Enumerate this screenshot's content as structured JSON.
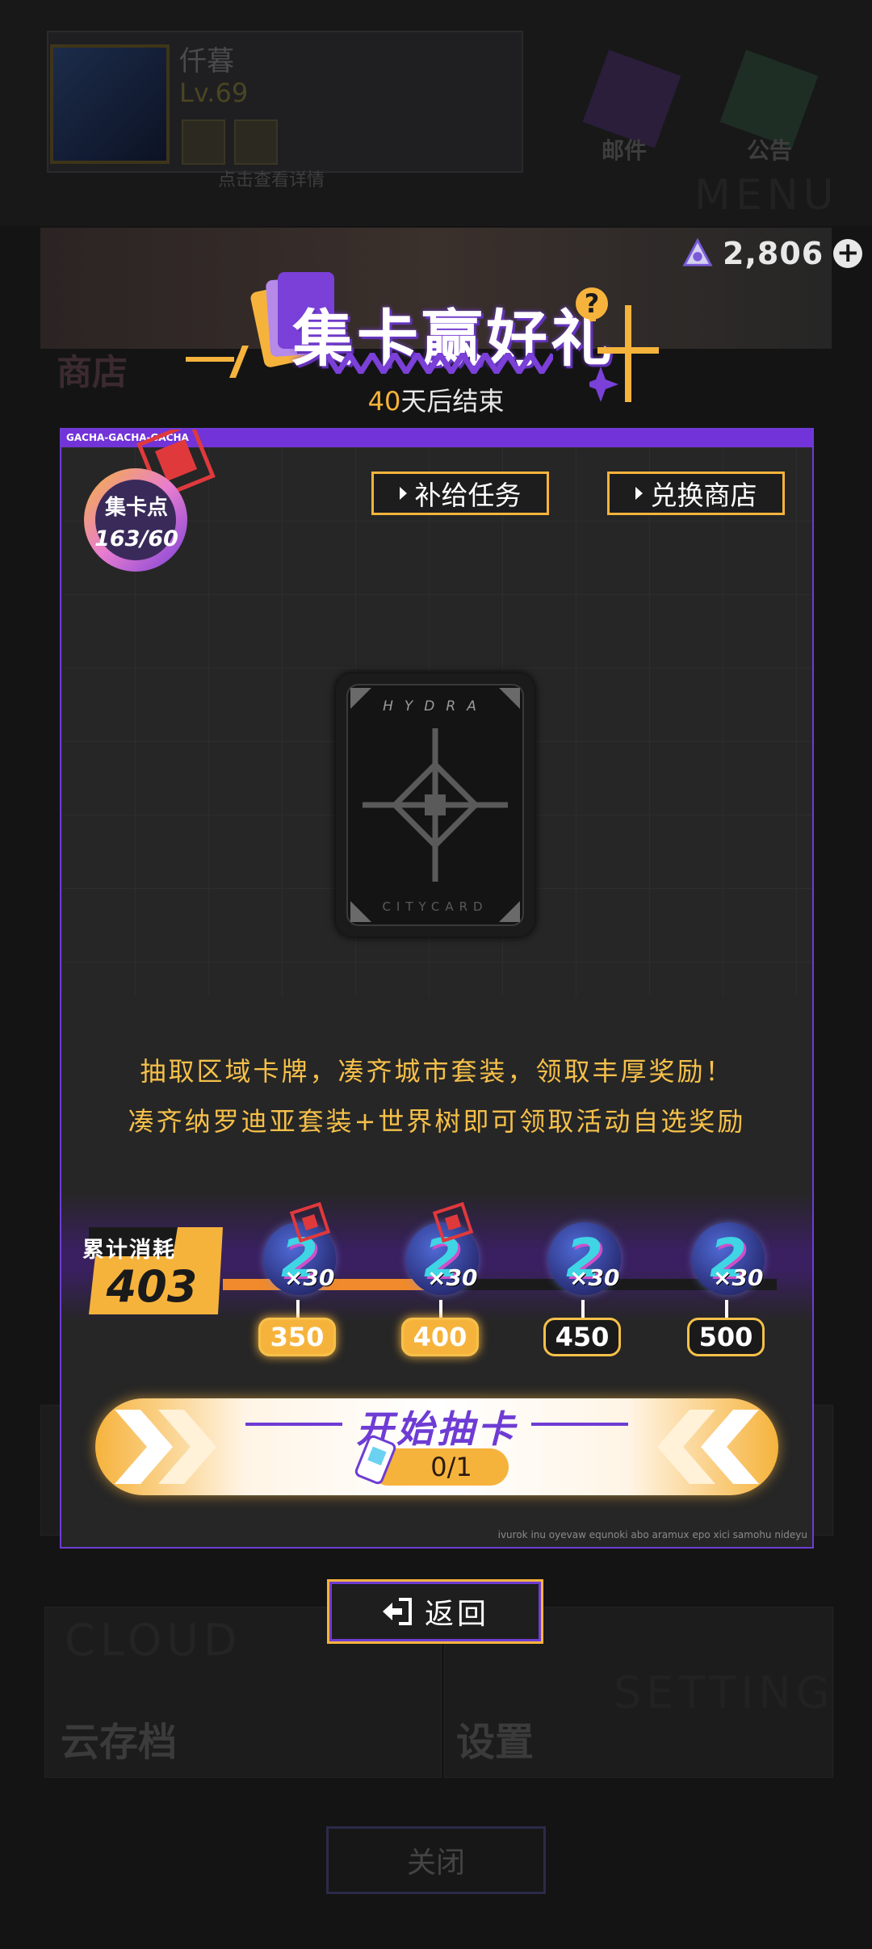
{
  "background": {
    "profile": {
      "name": "仟暮",
      "level": "Lv.69",
      "hint": "点击查看详情"
    },
    "mail_label": "邮件",
    "notice_label": "公告",
    "menu_word": "MENU",
    "shop_label": "商店",
    "cloud_word": "CLOUD",
    "cloud_label": "云存档",
    "setting_word": "SETTING",
    "setting_label": "设置",
    "close_label": "关闭"
  },
  "currency": {
    "value": "2,806",
    "icon": "gem-triangle-icon",
    "add_icon": "plus-icon"
  },
  "event": {
    "title": "集卡赢好礼",
    "help_icon": "?",
    "days_left": "40",
    "countdown_suffix": "天后结束"
  },
  "panel": {
    "header_tag": "GACHA-GACHA-GACHA",
    "points_label": "集卡点",
    "points_value": "163/60",
    "tabs": [
      {
        "label": "补给任务"
      },
      {
        "label": "兑换商店"
      }
    ],
    "card": {
      "top_text": "HYDRA",
      "bottom_text": "CITYCARD"
    },
    "desc_line1": "抽取区域卡牌，凑齐城市套装，领取丰厚奖励！",
    "desc_line2": "凑齐纳罗迪亚套装+世界树即可领取活动自选奖励",
    "consume_label": "累计消耗",
    "consume_value": "403",
    "milestones": [
      {
        "threshold": "350",
        "reward_qty": "×30",
        "reward_icon": "coin-2-icon",
        "reached": true
      },
      {
        "threshold": "400",
        "reward_qty": "×30",
        "reward_icon": "coin-2-icon",
        "reached": true
      },
      {
        "threshold": "450",
        "reward_qty": "×30",
        "reward_icon": "coin-2-icon",
        "reached": false
      },
      {
        "threshold": "500",
        "reward_qty": "×30",
        "reward_icon": "coin-2-icon",
        "reached": false
      }
    ],
    "progress_fraction": 0.38,
    "draw_button": {
      "label": "开始抽卡",
      "ticket_count": "0/1"
    },
    "footer_text": "ivurok inu oyevaw equnoki abo aramux epo xici samohu nideyu"
  },
  "back_button": {
    "label": "返回"
  },
  "colors": {
    "accent_purple": "#6e3cd4",
    "accent_gold": "#f6b33c",
    "panel_bg": "#262626"
  }
}
